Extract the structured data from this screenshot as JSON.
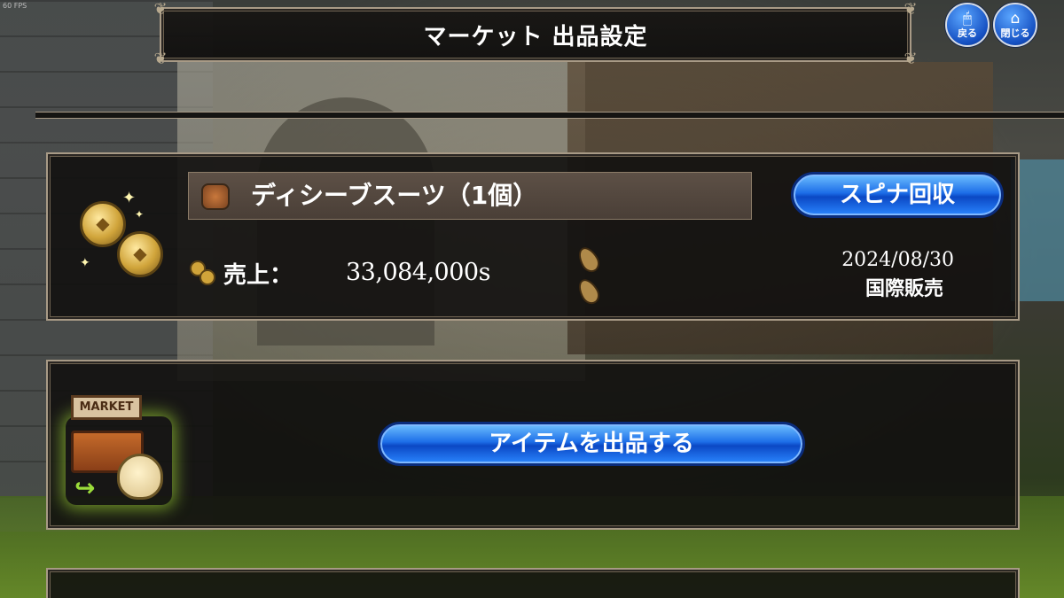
{
  "fps": "60 FPS",
  "header": {
    "title": "マーケット 出品設定"
  },
  "nav_buttons": {
    "back_label": "戻る",
    "close_label": "閉じる"
  },
  "listing": {
    "item_name": "ディシーブスーツ（1個）",
    "collect_button": "スピナ回収",
    "sales_label": "売上：",
    "sales_value": "33,084,000s",
    "date": "2024/08/30",
    "region": "国際販売"
  },
  "list_item_button": "アイテムを出品する",
  "market_icon_text": "MARKET",
  "colors": {
    "button_blue": "#1d6ee8",
    "panel_border": "#a89a86",
    "panel_bg": "#121110",
    "coin_gold": "#d0a43a"
  }
}
